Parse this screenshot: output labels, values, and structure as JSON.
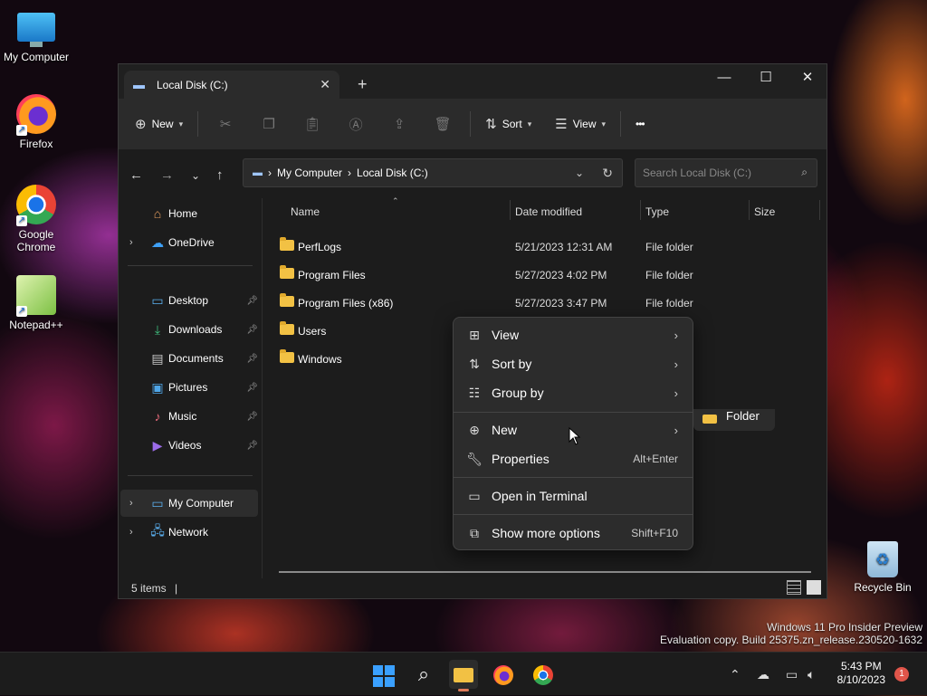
{
  "desktop": {
    "icons": [
      {
        "label": "My Computer",
        "icon": "monitor-icon"
      },
      {
        "label": "Firefox",
        "icon": "firefox-icon"
      },
      {
        "label": "Google Chrome",
        "icon": "chrome-icon"
      },
      {
        "label": "Notepad++",
        "icon": "notepadpp-icon"
      },
      {
        "label": "Recycle Bin",
        "icon": "recycle-bin-icon"
      }
    ]
  },
  "window": {
    "tab_title": "Local Disk (C:)",
    "tab_close": "✕",
    "new_tab": "+",
    "controls": {
      "minimize": "—",
      "maximize": "☐",
      "close": "✕"
    }
  },
  "toolbar": {
    "new_label": "New",
    "sort_label": "Sort",
    "view_label": "View",
    "more_label": "•••"
  },
  "address": {
    "segments": [
      "My Computer",
      "Local Disk (C:)"
    ],
    "separator": "›",
    "search_placeholder": "Search Local Disk (C:)"
  },
  "sidebar": {
    "items": [
      {
        "label": "Home",
        "icon": "home-icon",
        "color": "#e8a060"
      },
      {
        "label": "OneDrive",
        "icon": "onedrive-icon",
        "color": "#3ea0f5",
        "expandable": true
      },
      {
        "label": "Desktop",
        "icon": "desktop-icon",
        "color": "#5ab0f0",
        "pinned": true
      },
      {
        "label": "Downloads",
        "icon": "downloads-icon",
        "color": "#3fbf7f",
        "pinned": true
      },
      {
        "label": "Documents",
        "icon": "documents-icon",
        "color": "#c8c8c8",
        "pinned": true
      },
      {
        "label": "Pictures",
        "icon": "pictures-icon",
        "color": "#4fa6e8",
        "pinned": true
      },
      {
        "label": "Music",
        "icon": "music-icon",
        "color": "#e86a7a",
        "pinned": true
      },
      {
        "label": "Videos",
        "icon": "videos-icon",
        "color": "#9b6be8",
        "pinned": true
      },
      {
        "label": "My Computer",
        "icon": "computer-icon",
        "color": "#5ab0f0",
        "expandable": true,
        "selected": true
      },
      {
        "label": "Network",
        "icon": "network-icon",
        "color": "#5ab0f0",
        "expandable": true
      }
    ]
  },
  "columns": {
    "name": "Name",
    "date": "Date modified",
    "type": "Type",
    "size": "Size"
  },
  "files": [
    {
      "name": "PerfLogs",
      "date": "5/21/2023 12:31 AM",
      "type": "File folder"
    },
    {
      "name": "Program Files",
      "date": "5/27/2023 4:02 PM",
      "type": "File folder"
    },
    {
      "name": "Program Files (x86)",
      "date": "5/27/2023 3:47 PM",
      "type": "File folder"
    },
    {
      "name": "Users",
      "date": "",
      "type": ""
    },
    {
      "name": "Windows",
      "date": "",
      "type": ""
    }
  ],
  "status": {
    "count": "5 items",
    "caret": "|"
  },
  "context_menu": {
    "items": [
      {
        "label": "View",
        "icon": "grid-icon",
        "submenu": true
      },
      {
        "label": "Sort by",
        "icon": "sort-icon",
        "submenu": true
      },
      {
        "label": "Group by",
        "icon": "group-icon",
        "submenu": true
      },
      {
        "label": "New",
        "icon": "plus-circle-icon",
        "submenu": true
      },
      {
        "label": "Properties",
        "icon": "wrench-icon",
        "shortcut": "Alt+Enter"
      },
      {
        "label": "Open in Terminal",
        "icon": "terminal-icon"
      },
      {
        "label": "Show more options",
        "icon": "more-options-icon",
        "shortcut": "Shift+F10"
      }
    ],
    "submenu_item": "Folder"
  },
  "watermark": {
    "line1": "Windows 11 Pro Insider Preview",
    "line2": "Evaluation copy. Build 25375.zn_release.230520-1632"
  },
  "taskbar": {
    "apps": [
      "start-icon",
      "search-icon",
      "file-explorer-icon",
      "firefox-icon",
      "chrome-icon"
    ],
    "time": "5:43 PM",
    "date": "8/10/2023",
    "notification_count": "1"
  },
  "colors": {
    "accent": "#4aa3ff",
    "folder": "#f2c144",
    "window_bg": "#1c1c1c"
  }
}
